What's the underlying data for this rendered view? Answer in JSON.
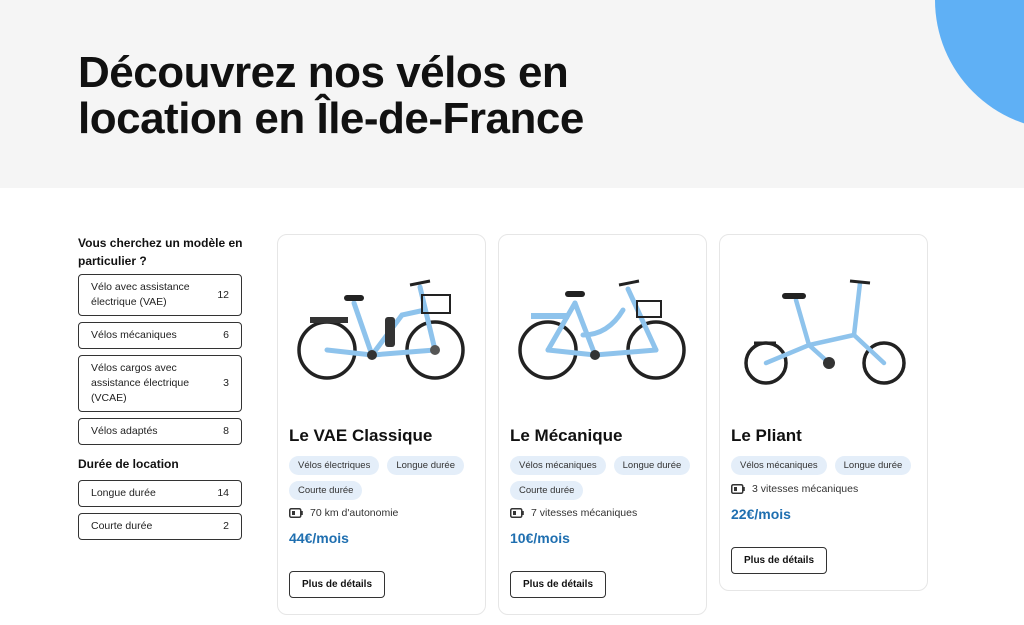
{
  "hero": {
    "title": "Découvrez nos vélos en location en Île-de-France"
  },
  "filters": {
    "model_title": "Vous cherchez un modèle en particulier ?",
    "models": [
      {
        "label": "Vélo avec assistance électrique (VAE)",
        "count": "12"
      },
      {
        "label": "Vélos mécaniques",
        "count": "6"
      },
      {
        "label": "Vélos cargos avec assistance électrique (VCAE)",
        "count": "3"
      },
      {
        "label": "Vélos adaptés",
        "count": "8"
      }
    ],
    "duration_title": "Durée de location",
    "durations": [
      {
        "label": "Longue durée",
        "count": "14"
      },
      {
        "label": "Courte durée",
        "count": "2"
      }
    ]
  },
  "products": [
    {
      "name": "Le VAE Classique",
      "tags": [
        "Vélos électriques",
        "Longue durée",
        "Courte durée"
      ],
      "spec": "70 km d'autonomie",
      "price": "44€/mois",
      "button": "Plus de détails"
    },
    {
      "name": "Le Mécanique",
      "tags": [
        "Vélos mécaniques",
        "Longue durée",
        "Courte durée"
      ],
      "spec": "7 vitesses mécaniques",
      "price": "10€/mois",
      "button": "Plus de détails"
    },
    {
      "name": "Le Pliant",
      "tags": [
        "Vélos mécaniques",
        "Longue durée"
      ],
      "spec": "3 vitesses mécaniques",
      "price": "22€/mois",
      "button": "Plus de détails"
    }
  ],
  "colors": {
    "accent": "#1f6fb0",
    "bike": "#8ec3ec",
    "tag_bg": "#e4eef9",
    "blob": "#5fb0f5"
  },
  "icons": {
    "spec": "battery-icon"
  }
}
